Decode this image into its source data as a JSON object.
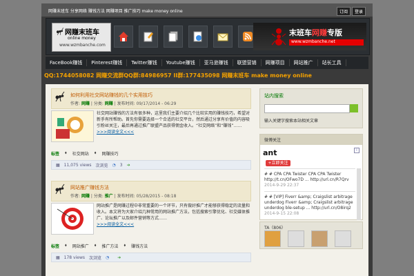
{
  "topbar": {
    "tagline": "网赚末班车 分享网络 赚钱方法 网赚项目 推广技巧 make money online",
    "links": [
      "订阅",
      "登录"
    ]
  },
  "header": {
    "logo_title": "网赚末班车",
    "logo_sub": "online money",
    "logo_url": "www.wzmbanche.com",
    "nav_icons": [
      "home-icon",
      "edit-icon",
      "documents-icon",
      "globe-page-icon",
      "mail-icon",
      "rss-icon"
    ],
    "banner_title_a": "末班车",
    "banner_title_b": "网赚",
    "banner_title_c": "专版",
    "banner_url": "www.wzmbanche.net"
  },
  "menu": [
    "FaceBook赚钱",
    "Pinterest赚钱",
    "Twitter赚钱",
    "Youtube赚钱",
    "亚马逊赚钱",
    "联盟营销",
    "网赚项目",
    "网站推广",
    "站长工具"
  ],
  "ticker": "QQ:1744058082 网赚交流群QQ群:84986957 II群:177435098 网赚末班车 make money online",
  "posts": [
    {
      "title": "如何利用社交网站赚钱的几个实用技巧",
      "author_label": "作者:",
      "author": "网赚",
      "category_label": "分类:",
      "category": "网赚",
      "date_label": "发布时间:",
      "date": "09/17/2014 - 06:29",
      "excerpt": "社交网站赚钱的方法有很多种，这里我们主要介绍几个比较实用的赚钱技巧，希望对新手有所帮助。首先你需要选择一个合适的社交平台，然后通过分享有价值的内容吸引粉丝关注，最后再通过推广联盟产品获得佣金收入。“社交网络”和“赚钱”……",
      "more": ">>>阅读全文<<<",
      "tags_label": "标签",
      "tags": [
        "社交网站",
        "网赚技巧"
      ],
      "views": "11,075 views",
      "views_suffix": "次浏览",
      "comments": "3"
    },
    {
      "title": "网站推广赚钱方法",
      "author_label": "作者:",
      "author": "网赚",
      "category_label": "分类:",
      "category": "推广",
      "date_label": "发布时间:",
      "date": "05/28/2015 - 08:18",
      "excerpt": "网站推广是网赚过程中非常重要的一个环节，只有做好推广才能够获得稳定的流量和收入。本文将为大家介绍几种常用的网站推广方法，包括搜索引擎优化、社交媒体推广、论坛推广以及邮件营销等方式……",
      "more": ">>>阅读全文<<<",
      "tags_label": "标签",
      "tags": [
        "网站推广",
        "推广方法",
        "赚钱方法"
      ],
      "views": "178 views",
      "views_suffix": "次浏览",
      "comments": ""
    }
  ],
  "sidebar": {
    "search_title": "站内搜索",
    "search_placeholder": "",
    "search_hint": "输入关键字搜索本站相关文章",
    "weibo_title": "微博关注",
    "follow_label": "+立即关注",
    "feed": [
      {
        "text": "# # CPA CPA Twister CPA CPA Twister http://t.cn/OFwo7D ... http://url.cn/R7Qrv",
        "time": "2014-9-29 22:37"
      },
      {
        "text": "# # [VIP] Fiverr &amp; Craigslist arbitrage underdog Fiverr &amp; Craigslist arbitrage underdog ble-setup ... http://url.cn/O8irq2",
        "time": "2014-9-15 22:08"
      }
    ],
    "ta_title": "TA（806）"
  }
}
